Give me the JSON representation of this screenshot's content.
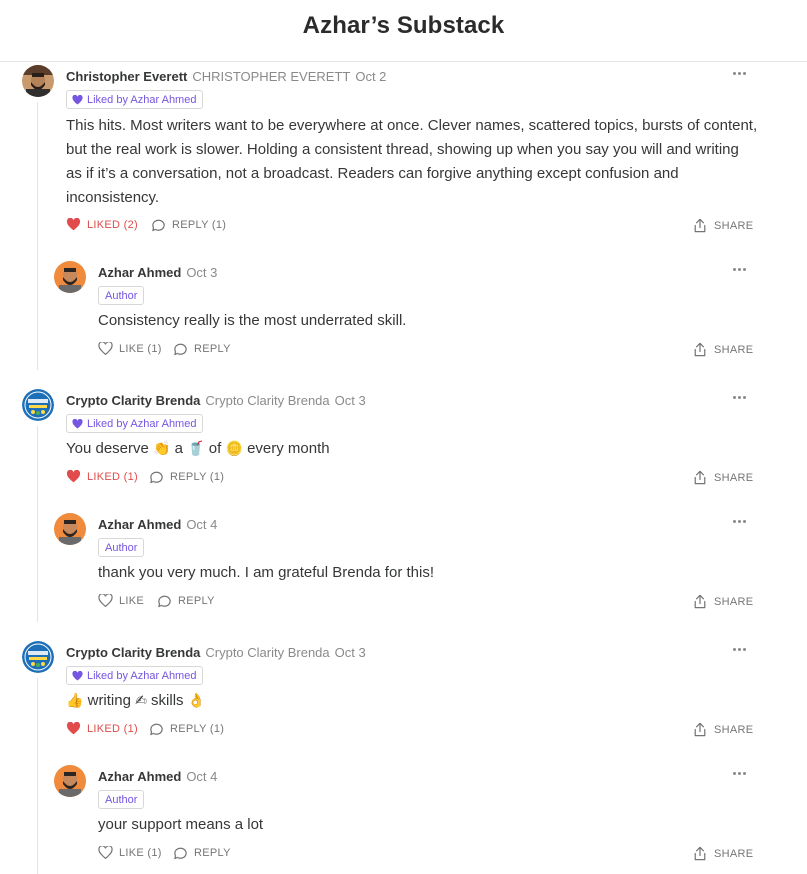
{
  "header": {
    "title": "Azhar’s Substack"
  },
  "icons": {
    "heart": "heart-icon",
    "reply": "speech-bubble-icon",
    "share": "share-icon",
    "more": "more-horizontal-icon",
    "liked_heart": "small-heart-icon"
  },
  "colors": {
    "liked": "#e14b4b",
    "accent": "#7655e2",
    "meta": "#8a8a8a"
  },
  "share_label": "SHARE",
  "threads": [
    {
      "comment": {
        "author": "Christopher Everett",
        "handle": "CHRISTOPHER EVERETT",
        "date": "Oct 2",
        "badge": "Liked by Azhar Ahmed",
        "lines": [
          "This hits. Most writers want to be everywhere at once. Clever names, scattered topics, bursts of content,",
          "but the real work is slower. Holding a consistent thread, showing up when you say you will and writing",
          "as if it’s a conversation, not a broadcast. Readers can forgive anything except confusion and",
          "inconsistency."
        ],
        "like_label": "LIKED (2)",
        "reply_label": "REPLY (1)"
      },
      "reply": {
        "author": "Azhar Ahmed",
        "date": "Oct 3",
        "badge": "Author",
        "text": "Consistency really is the most underrated skill.",
        "like_label": "LIKE (1)",
        "reply_label": "REPLY"
      }
    },
    {
      "comment": {
        "author": "Crypto Clarity Brenda",
        "handle": "Crypto Clarity Brenda",
        "date": "Oct 3",
        "badge": "Liked by Azhar Ahmed",
        "segments": [
          "You deserve",
          "a",
          "of",
          "every month"
        ],
        "like_label": "LIKED (1)",
        "reply_label": "REPLY (1)"
      },
      "reply": {
        "author": "Azhar Ahmed",
        "date": "Oct 4",
        "badge": "Author",
        "text": "thank you very much. I am grateful Brenda for this!",
        "like_label": "LIKE",
        "reply_label": "REPLY"
      }
    },
    {
      "comment": {
        "author": "Crypto Clarity Brenda",
        "handle": "Crypto Clarity Brenda",
        "date": "Oct 3",
        "badge": "Liked by Azhar Ahmed",
        "segments": [
          "writing",
          "skills"
        ],
        "like_label": "LIKED (1)",
        "reply_label": "REPLY (1)"
      },
      "reply": {
        "author": "Azhar Ahmed",
        "date": "Oct 4",
        "badge": "Author",
        "text": "your support means a lot",
        "like_label": "LIKE (1)",
        "reply_label": "REPLY"
      }
    }
  ]
}
